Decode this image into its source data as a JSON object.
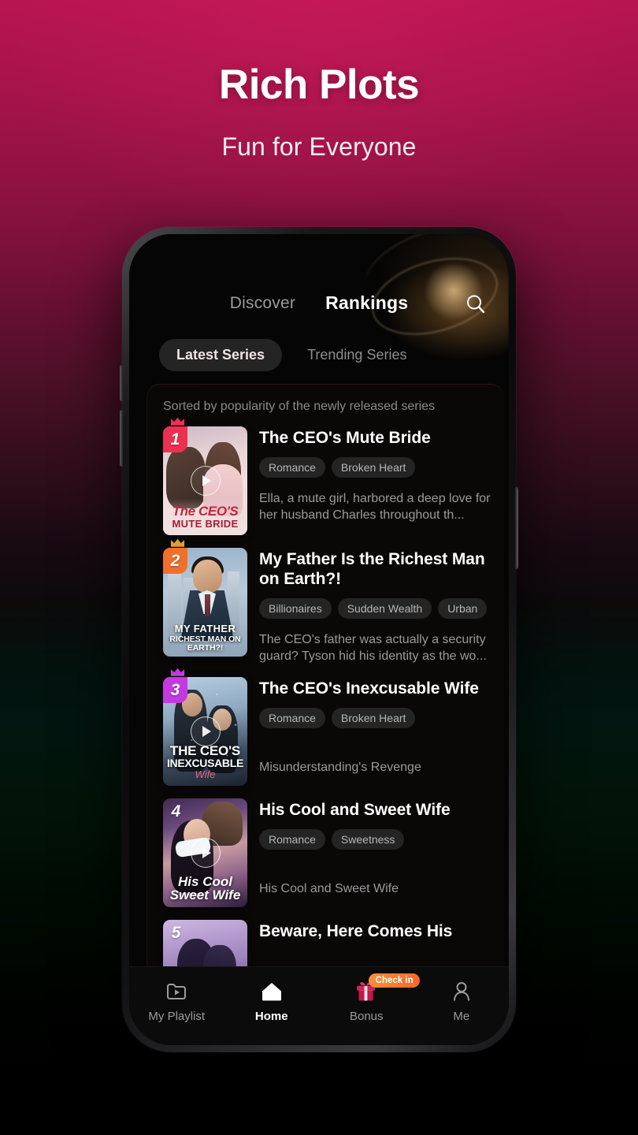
{
  "promo": {
    "title": "Rich Plots",
    "subtitle": "Fun for Everyone"
  },
  "colors": {
    "bg_top": "#b71550",
    "bg_mid": "#021510",
    "bg_bottom": "#000000",
    "accent_red": "#ec3150",
    "accent_orange": "#f0702a",
    "accent_purple": "#c43ae0",
    "checkin_badge": "#f4682c",
    "active_text": "#ffffff",
    "muted_text": "#9b9b9b"
  },
  "app": {
    "top_tabs": [
      {
        "label": "Discover",
        "active": false
      },
      {
        "label": "Rankings",
        "active": true
      }
    ],
    "search_icon": "search-icon",
    "segments": [
      {
        "label": "Latest Series",
        "active": true
      },
      {
        "label": "Trending Series",
        "active": false
      }
    ],
    "sorted_note": "Sorted by popularity of the newly released series",
    "series": [
      {
        "rank": "1",
        "badge_color": "#ec3150",
        "crown": true,
        "crown_color": "#ec3150",
        "title": "The CEO's Mute Bride",
        "tags": [
          "Romance",
          "Broken Heart"
        ],
        "description": "Ella, a mute girl, harbored a deep love for her husband Charles throughout th...",
        "poster_lines": [
          "The CEO'S",
          "MUTE BRIDE"
        ],
        "has_play": true
      },
      {
        "rank": "2",
        "badge_color": "#f0702a",
        "crown": true,
        "crown_color": "#e0a02c",
        "title": "My Father Is the Richest Man on Earth?!",
        "tags": [
          "Billionaires",
          "Sudden Wealth",
          "Urban"
        ],
        "description": "The CEO's father was actually a security guard? Tyson hid his identity as the wo...",
        "poster_lines": [
          "MY FATHER",
          "RICHEST MAN ON EARTH?!"
        ],
        "has_play": false
      },
      {
        "rank": "3",
        "badge_color": "#c43ae0",
        "crown": true,
        "crown_color": "#c43ae0",
        "title": "The CEO's Inexcusable Wife",
        "tags": [
          "Romance",
          "Broken Heart"
        ],
        "description": "Misunderstanding's Revenge",
        "poster_lines": [
          "THE CEO'S",
          "INEXCUSABLE",
          "Wife"
        ],
        "has_play": true
      },
      {
        "rank": "4",
        "badge_color": "transparent",
        "crown": false,
        "crown_color": "",
        "title": "His Cool and Sweet Wife",
        "tags": [
          "Romance",
          "Sweetness"
        ],
        "description": "His Cool and Sweet Wife",
        "poster_lines": [
          "His Cool",
          "Sweet Wife"
        ],
        "has_play": true
      },
      {
        "rank": "5",
        "badge_color": "transparent",
        "crown": false,
        "crown_color": "",
        "title": "Beware, Here Comes His",
        "tags": [],
        "description": "",
        "poster_lines": [],
        "has_play": false
      }
    ],
    "bottom_nav": [
      {
        "label": "My Playlist",
        "icon": "playlist-folder-icon",
        "active": false,
        "badge": ""
      },
      {
        "label": "Home",
        "icon": "home-icon",
        "active": true,
        "badge": ""
      },
      {
        "label": "Bonus",
        "icon": "gift-icon",
        "active": false,
        "badge": "Check in"
      },
      {
        "label": "Me",
        "icon": "person-icon",
        "active": false,
        "badge": ""
      }
    ]
  }
}
